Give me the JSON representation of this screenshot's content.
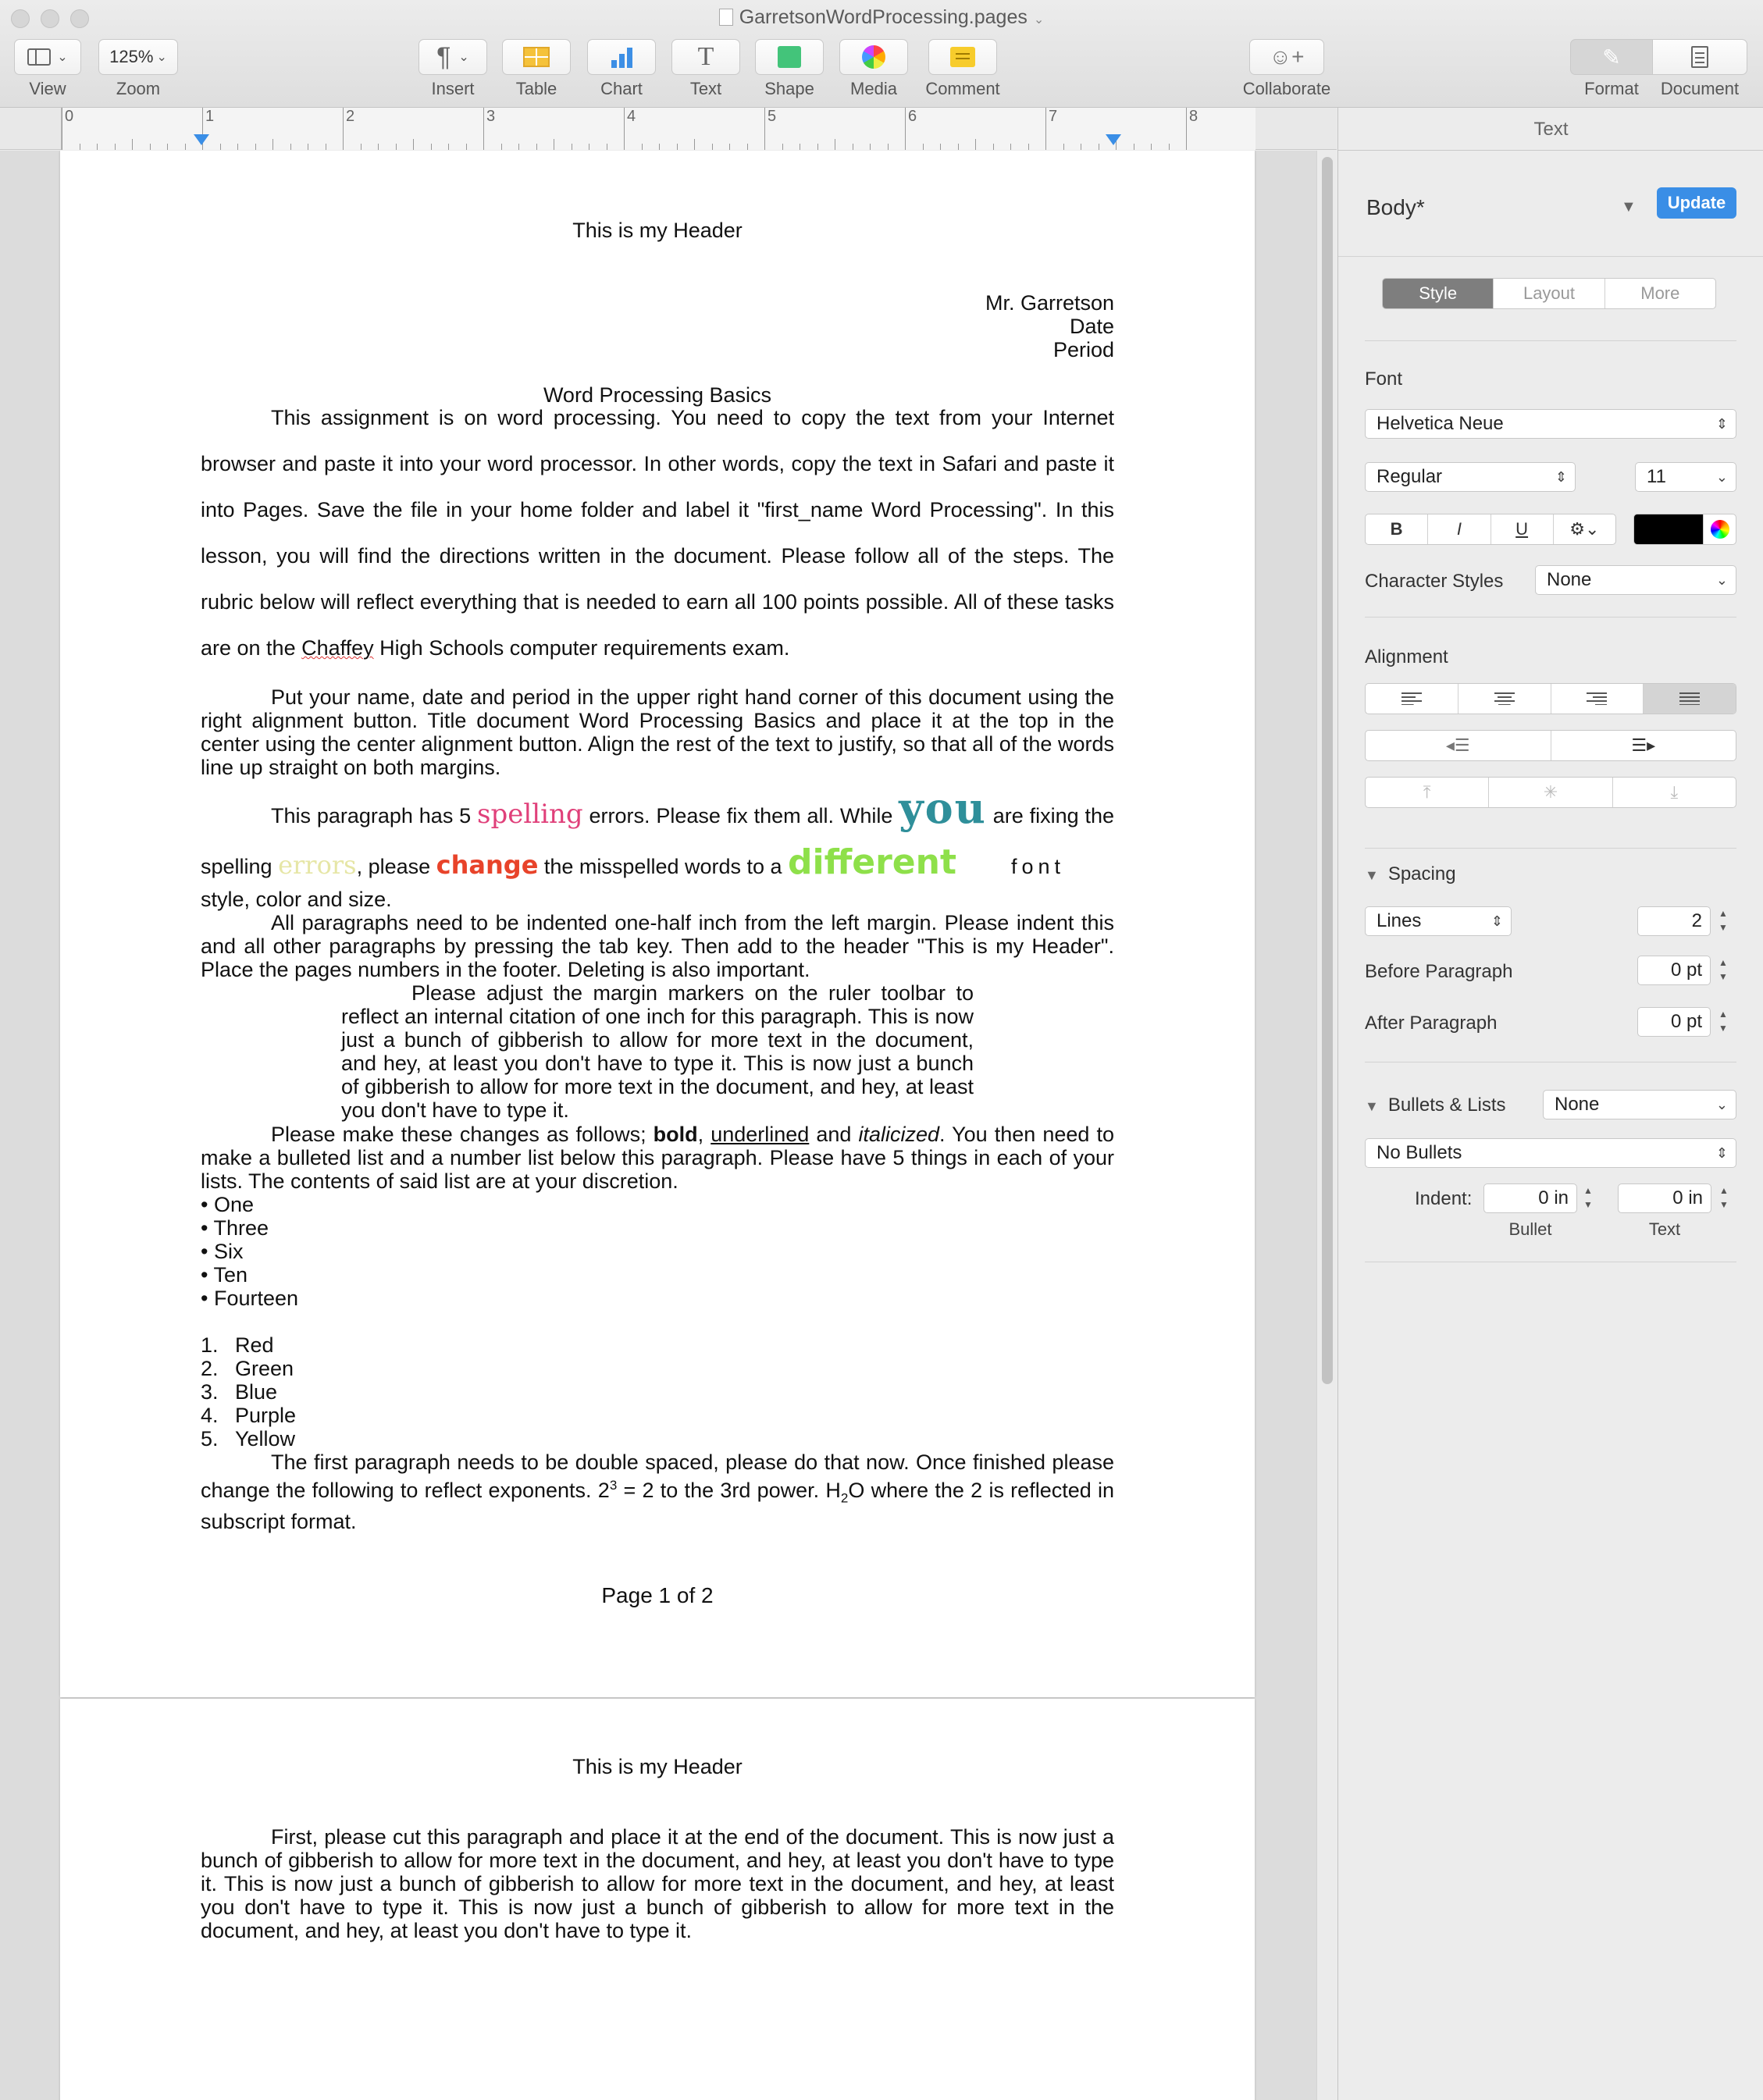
{
  "window": {
    "title": "GarretsonWordProcessing.pages"
  },
  "toolbar": {
    "view_label": "View",
    "zoom_value": "125%",
    "zoom_label": "Zoom",
    "insert_label": "Insert",
    "table_label": "Table",
    "chart_label": "Chart",
    "text_label": "Text",
    "shape_label": "Shape",
    "media_label": "Media",
    "comment_label": "Comment",
    "collaborate_label": "Collaborate",
    "format_label": "Format",
    "document_label": "Document"
  },
  "ruler": {
    "numbers": [
      "0",
      "1",
      "2",
      "3",
      "4",
      "5",
      "6",
      "7",
      "8"
    ]
  },
  "doc": {
    "header": "This is my Header",
    "name": "Mr. Garretson",
    "date": "Date",
    "period": "Period",
    "title": "Word Processing Basics",
    "p1_a": "This assignment is on word processing.  You need to copy the text from your Internet browser and paste it into your word processor.  In other words, copy the text in Safari and paste it into Pages.   Save the file in your home folder and label it \"first_name Word Processing\".  In this lesson, you will find the directions written in the document.  Please follow all of the steps.  The rubric below will reflect everything that is needed to earn all 100 points possible.  All of these tasks are on the ",
    "p1_chaffey": "Chaffey",
    "p1_b": " High Schools computer requirements exam.",
    "p2": "Put your name, date and period in the upper right hand corner of this document using the right alignment button.  Title document Word Processing Basics and place it at the top in the center using the center alignment button.  Align the rest of the text to justify, so that all of the words line up straight on both margins.",
    "p3_a": "This paragraph has 5 ",
    "p3_spelling": "spelling",
    "p3_b": " errors.  Please fix them all.  While ",
    "p3_you": "you",
    "p3_c": " are fixing the spelling ",
    "p3_errors": "errors",
    "p3_d": ", please ",
    "p3_change": "change",
    "p3_e": " the misspelled words to a ",
    "p3_different": "different",
    "p3_font": "font",
    "p3_f": "style, color and size.",
    "p4": "All paragraphs need to be indented one-half inch from the left margin.  Please indent this and all other paragraphs by pressing the tab key.  Then add to the header \"This is my Header\".  Place the pages numbers in the footer.  Deleting is also important.",
    "p5": "Please adjust the margin markers on the ruler toolbar to reflect an internal citation of one inch for this paragraph.  This is now just a bunch of gibberish to allow for more text in the document, and hey, at least you don't have to type it. This is now just a bunch of gibberish to allow for more text in the document, and hey, at least you don't have to type it.",
    "p6_a": "Please make these changes as follows; ",
    "p6_bold": "bold",
    "p6_b": ", ",
    "p6_underlined": "underlined",
    "p6_c": " and ",
    "p6_italic": "italicized",
    "p6_d": ".  You then need to make a bulleted list and a number list below this paragraph.  Please have 5 things in each of your lists.  The contents of said list are at your discretion.",
    "bullets": [
      "One",
      "Three",
      "Six",
      "Ten",
      "Fourteen"
    ],
    "numbers": [
      "Red",
      "Green",
      "Blue",
      "Purple",
      "Yellow"
    ],
    "p7_a": "The first paragraph needs to be double spaced, please do that now.  Once finished please change the following to reflect exponents.  2",
    "p7_sup": "3",
    "p7_b": " = 2 to the 3rd power.  H",
    "p7_sub": "2",
    "p7_c": "O where the 2 is reflected in subscript format.",
    "footer": "Page 1 of 2",
    "page2_header": "This is my Header",
    "page2_p1": "First, please cut this paragraph and place it at the end of the document.  This is now just a bunch of gibberish to allow for more text in the document, and hey, at least you don't have to type it.  This is now just a bunch of gibberish to allow for more text in the document, and hey, at least you don't have to type it.  This is now just a bunch of gibberish to allow for more text in the document, and hey, at least you don't have to type it."
  },
  "inspector": {
    "title": "Text",
    "style_name": "Body*",
    "update_label": "Update",
    "tabs": [
      "Style",
      "Layout",
      "More"
    ],
    "font_label": "Font",
    "font_family": "Helvetica Neue",
    "font_weight": "Regular",
    "font_size": "11",
    "bold_label": "B",
    "italic_label": "I",
    "underline_label": "U",
    "char_styles_label": "Character Styles",
    "char_styles_value": "None",
    "alignment_label": "Alignment",
    "spacing_label": "Spacing",
    "lines_value": "Lines",
    "lines_number": "2",
    "before_para_label": "Before Paragraph",
    "before_para_value": "0 pt",
    "after_para_label": "After Paragraph",
    "after_para_value": "0 pt",
    "bullets_label": "Bullets & Lists",
    "bullets_value": "None",
    "no_bullets_value": "No Bullets",
    "indent_label": "Indent:",
    "indent_bullet_value": "0 in",
    "indent_text_value": "0 in",
    "bullet_sublabel": "Bullet",
    "text_sublabel": "Text"
  },
  "colors": {
    "accent": "#3a8ee6",
    "text_color_well": "#000000"
  }
}
